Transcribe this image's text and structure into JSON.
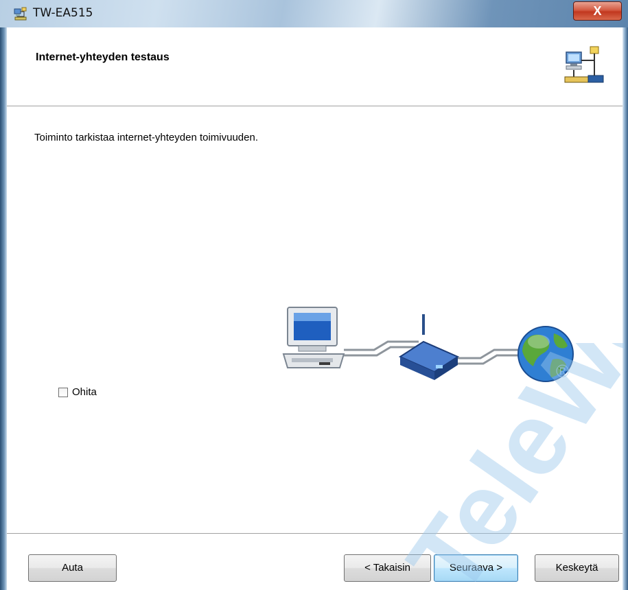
{
  "window": {
    "title": "TW-EA515",
    "close_label": "X"
  },
  "header": {
    "title": "Internet-yhteyden testaus"
  },
  "main": {
    "description": "Toiminto tarkistaa internet-yhteyden toimivuuden.",
    "skip_checkbox": {
      "label": "Ohita",
      "checked": false
    }
  },
  "watermark": {
    "text": "TeleWell",
    "registered_mark": "®"
  },
  "footer": {
    "help_label": "Auta",
    "back_label": "< Takaisin",
    "next_label": "Seuraava >",
    "cancel_label": "Keskeytä"
  },
  "icons": {
    "app": "network-wizard-icon",
    "header": "network-connection-icon",
    "illustration": [
      "computer-icon",
      "router-icon",
      "globe-icon"
    ]
  },
  "colors": {
    "close_button": "#c83d23",
    "primary_button_border": "#3c7fb1",
    "watermark": "#9cc8ec"
  }
}
